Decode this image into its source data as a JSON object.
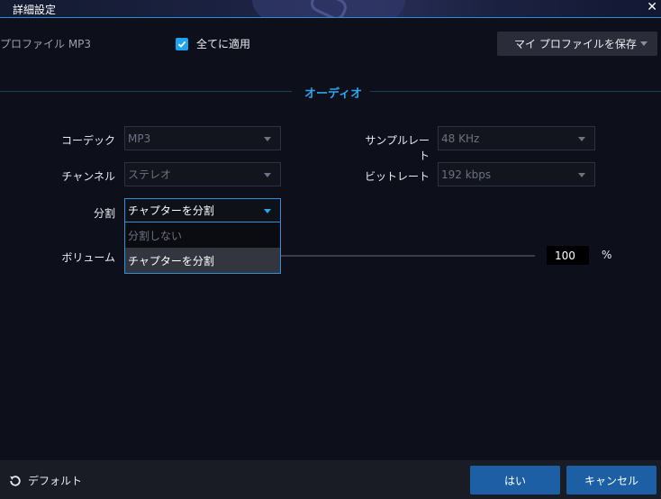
{
  "window": {
    "title": "詳細設定",
    "close_label": "✕"
  },
  "profile": {
    "label": "プロファイル MP3"
  },
  "apply_all": {
    "label": "全てに適用",
    "checked": true
  },
  "save_profile": {
    "label": "マイ プロファイルを保存"
  },
  "section": {
    "title": "オーディオ"
  },
  "fields": {
    "codec": {
      "label": "コーデック",
      "value": "MP3"
    },
    "sample_rate": {
      "label": "サンプルレート",
      "value": "48 KHz"
    },
    "channel": {
      "label": "チャンネル",
      "value": "ステレオ"
    },
    "bitrate": {
      "label": "ビットレート",
      "value": "192 kbps"
    },
    "split": {
      "label": "分割",
      "value": "チャプターを分割",
      "options": [
        "分割しない",
        "チャプターを分割"
      ]
    },
    "volume": {
      "label": "ボリューム",
      "value": "100",
      "unit": "%"
    }
  },
  "footer": {
    "default_label": "デフォルト",
    "ok_label": "はい",
    "cancel_label": "キャンセル"
  },
  "colors": {
    "accent": "#2ea4ec",
    "button": "#1c5fa4",
    "background": "#0d0f1b"
  }
}
